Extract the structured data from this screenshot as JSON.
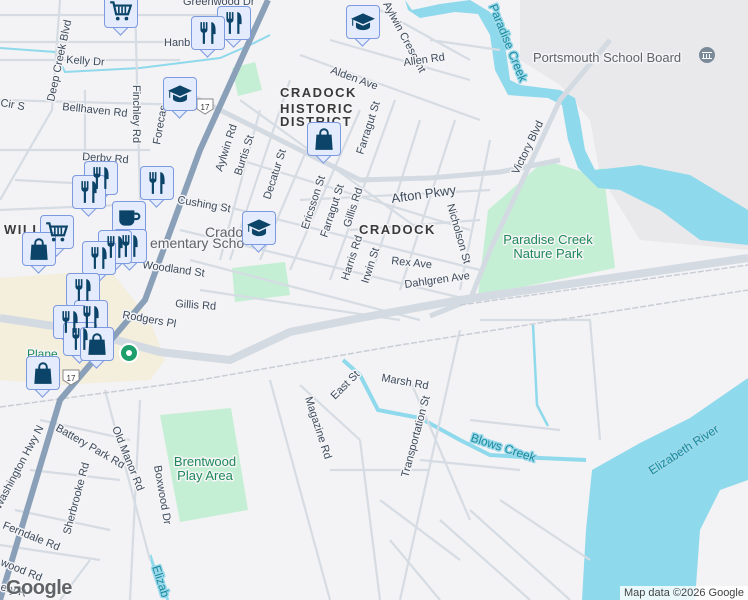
{
  "map": {
    "district_labels": [
      "CRADOCK",
      "HISTORIC",
      "DISTRICT",
      "CRADOCK",
      "WILL"
    ],
    "streets": [
      "Greenwood Dr",
      "Aylwin Crescent",
      "Allen Rd",
      "Alden Ave",
      "Deep Creek Blvd",
      "Kelly Dr",
      "Hanb",
      "Cir S",
      "Bellhaven Rd",
      "Finchley Rd",
      "Forecas",
      "Aylwin Rd",
      "Burtis St",
      "Decatur St",
      "Farragut St",
      "Derby Rd",
      "Cushing St",
      "Ericsson St",
      "Farragut St",
      "Gillis Rd",
      "Afton Pkwy",
      "Nicholson St",
      "Victory Blvd",
      "Harris Rd",
      "Irwin St",
      "Rex Ave",
      "Dahlgren Ave",
      "Woodland St",
      "Gillis Rd",
      "Rodgers Pl",
      "East St",
      "Marsh Rd",
      "Magazine Rd",
      "Transportation St",
      "Battery Park Rd",
      "Old Manor Rd",
      "Boxwood Dr",
      "Sherbrooke Rd",
      "Washington Hwy N",
      "Ferndale Rd",
      "wood Rd",
      "ery R"
    ],
    "parks": [
      "Paradise Creek",
      "Nature Park",
      "Brentwood",
      "Play Area"
    ],
    "water": [
      "Paradise Creek",
      "Blows Creek",
      "Elizabeth River",
      "Elizab"
    ],
    "pois": [
      "Portsmouth School Board",
      "Crado",
      "ementary Scho",
      "Plane"
    ],
    "route_shield": "17",
    "attribution": "Map data ©2026 Google",
    "logo": "Google"
  },
  "markers": [
    {
      "icon": "cart-icon"
    },
    {
      "icon": "restaurant-icon"
    },
    {
      "icon": "restaurant-icon"
    },
    {
      "icon": "school-icon"
    },
    {
      "icon": "school-icon"
    },
    {
      "icon": "shopping-bag-icon"
    },
    {
      "icon": "restaurant-icon"
    },
    {
      "icon": "restaurant-icon"
    },
    {
      "icon": "cafe-icon"
    },
    {
      "icon": "school-icon"
    },
    {
      "icon": "shopping-bag-icon"
    },
    {
      "icon": "restaurant-icon"
    },
    {
      "icon": "shopping-bag-icon"
    },
    {
      "icon": "shopping-bag-icon"
    }
  ],
  "colors": {
    "water": "#8fd9ec",
    "park": "#c5efd4",
    "highway": "#8aa0b9",
    "marker_fill": "#e4ebfc",
    "marker_icon": "#0b4468"
  }
}
